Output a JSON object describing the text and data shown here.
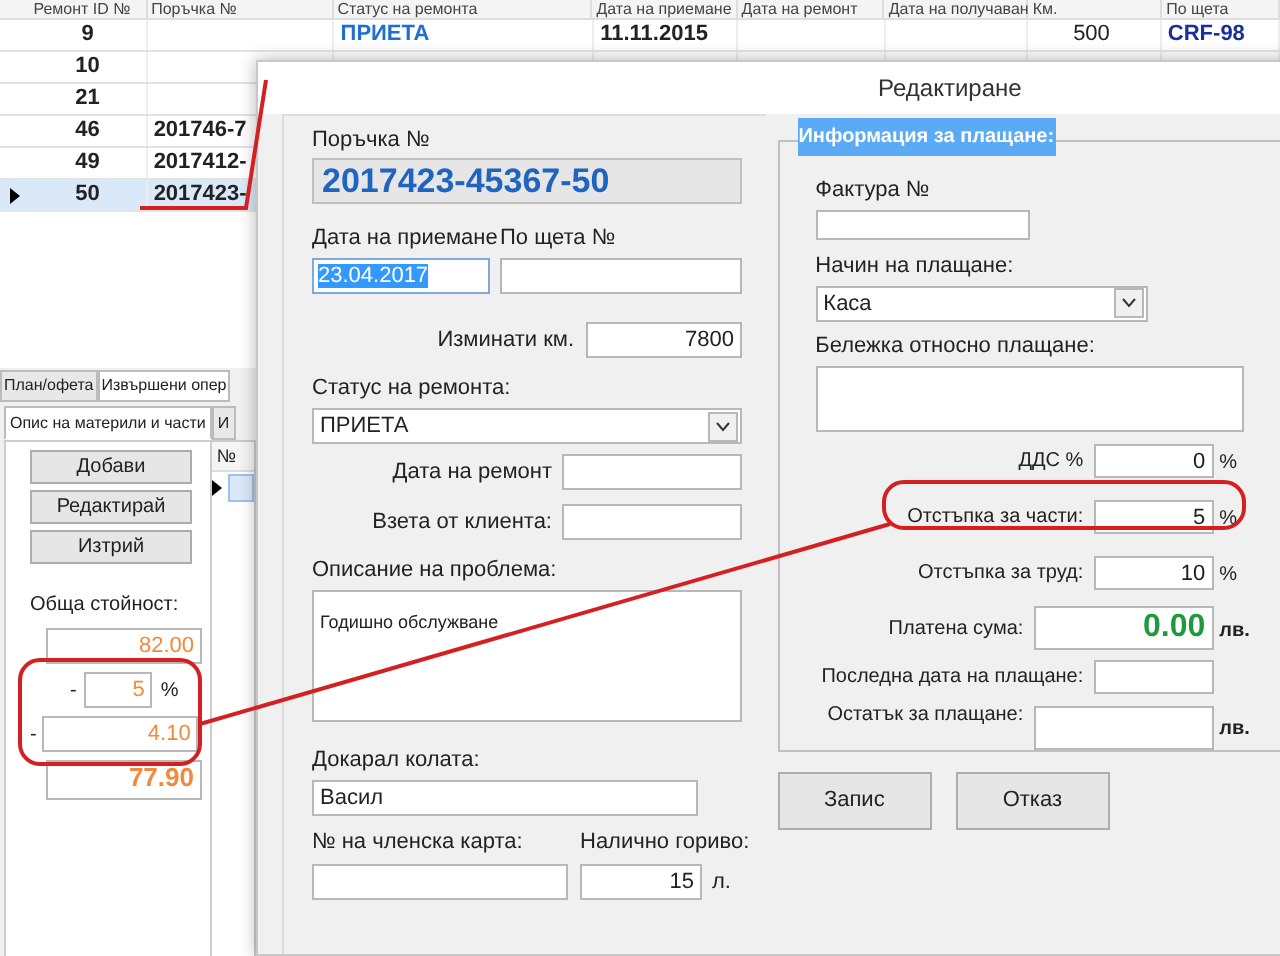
{
  "grid": {
    "columns": [
      "Ремонт ID №",
      "Поръчка №",
      "Статус на ремонта",
      "Дата на приемане",
      "Дата на ремонт",
      "Дата на получаван",
      "Км.",
      "По щета"
    ],
    "rows": [
      {
        "cells": [
          "9",
          "",
          "ПРИЕТА",
          "11.11.2015",
          "",
          "",
          "500",
          "CRF-98"
        ],
        "selected": false
      },
      {
        "cells": [
          "10"
        ],
        "selected": false
      },
      {
        "cells": [
          "21"
        ],
        "selected": false
      },
      {
        "cells": [
          "46",
          "201746-7"
        ],
        "selected": false
      },
      {
        "cells": [
          "49",
          "2017412-"
        ],
        "selected": false
      },
      {
        "cells": [
          "50",
          "2017423-"
        ],
        "selected": true
      }
    ]
  },
  "lower_panel": {
    "tabs": [
      {
        "label": "План/офета",
        "selected": false
      },
      {
        "label": "Извършени опер",
        "selected": true
      }
    ],
    "subtabs": [
      {
        "label": "Опис на материли и части",
        "selected": true
      },
      {
        "label": "И",
        "selected": false
      }
    ],
    "buttons": [
      "Добави",
      "Редактирай",
      "Изтрий"
    ],
    "total_label": "Обща стойност:",
    "total": "82.00",
    "discount_sign": "-",
    "discount": "5",
    "discount_unit": "%",
    "amount_sign": "-",
    "amount": "4.10",
    "final": "77.90",
    "mini_grid": {
      "column": "№"
    }
  },
  "dialog": {
    "title": "Редактиране",
    "order_label": "Поръчка №",
    "order_number": "2017423-45367-50",
    "date_received_label": "Дата на приемане",
    "date_received": "23.04.2017",
    "date_received_highlighted": true,
    "claim_label": "По щета №",
    "km_label": "Изминати км.",
    "km": "7800",
    "status_label": "Статус на ремонта:",
    "status": "ПРИЕТА",
    "repair_date_label": "Дата на ремонт",
    "taken_label": "Взета от клиента:",
    "problem_label": "Описание на проблема:",
    "problem": "Годишно обслужване",
    "brought_label": "Докарал колата:",
    "brought": "Васил",
    "card_label": "№ на членска карта:",
    "fuel_label": "Налично гориво:",
    "fuel": "15",
    "fuel_unit": "л.",
    "payment": {
      "title": "Информация за плащане:",
      "invoice_label": "Фактура №",
      "method_label": "Начин на плащане:",
      "method": "Каса",
      "note_label": "Бележка относно плащане:",
      "rows": [
        {
          "kind": "percent",
          "label": "ДДС %",
          "value": "0",
          "unit": "%"
        },
        {
          "kind": "percent",
          "label": "Отстъпка за части:",
          "value": "5",
          "unit": "%"
        },
        {
          "kind": "percent",
          "label": "Отстъпка за труд:",
          "value": "10",
          "unit": "%"
        },
        {
          "kind": "amount",
          "label": "Платена сума:",
          "value": "0.00",
          "unit": "лв."
        },
        {
          "kind": "date",
          "label": "Последна дата на плащане:"
        },
        {
          "kind": "remaining",
          "label": "Остатък за плащане:",
          "unit": "лв."
        }
      ]
    },
    "buttons": [
      "Запис",
      "Отказ"
    ]
  }
}
